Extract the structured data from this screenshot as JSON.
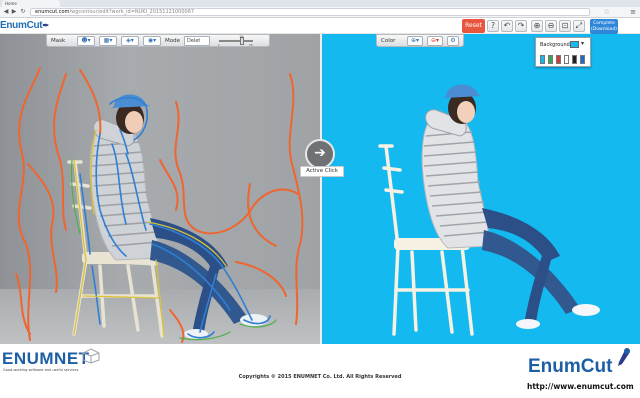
{
  "browser": {
    "tab_title": "Home",
    "url_host": "enumcut.com",
    "url_path": "/wgcontour/edit?work_id=NUKI_20151121000067"
  },
  "header": {
    "logo_text": "EnumCut",
    "reset_label": "Reset",
    "complete_label": "Complete",
    "complete_sub": "(Download)"
  },
  "left_toolbar": {
    "mask_label": "Mask",
    "mode_label": "Mode",
    "mode_value": "Delet",
    "slider_value": "18",
    "slider_min": "1",
    "slider_max": "25",
    "slider_scale_marks": [
      "1",
      "5",
      "10",
      "15",
      "20",
      "25"
    ],
    "slider_level": 0.68
  },
  "right_toolbar": {
    "color_label": "Color"
  },
  "background_popup": {
    "label": "Background",
    "selected_color": "#13b9ef",
    "swatches": [
      "#13b9ef",
      "#3aa655",
      "#d23b3b",
      "#ffffff",
      "#222222",
      "#1d6bd1"
    ]
  },
  "center": {
    "active_label": "Active Click"
  },
  "footer": {
    "enumnet_logo": "ENUMNET",
    "enumnet_tagline": "Good-working   software and  useful  services",
    "copyright": "Copyrights © 2015 ENUMNET Co. Ltd. All Rights Reserved",
    "enumcut_logo": "EnumCut",
    "enumcut_url": "http://www.enumcut.com"
  },
  "colors": {
    "accent_blue": "#1f6db3",
    "reset_red": "#e8563f",
    "complete_blue": "#2f87d9",
    "sky_background": "#13b9ef"
  }
}
